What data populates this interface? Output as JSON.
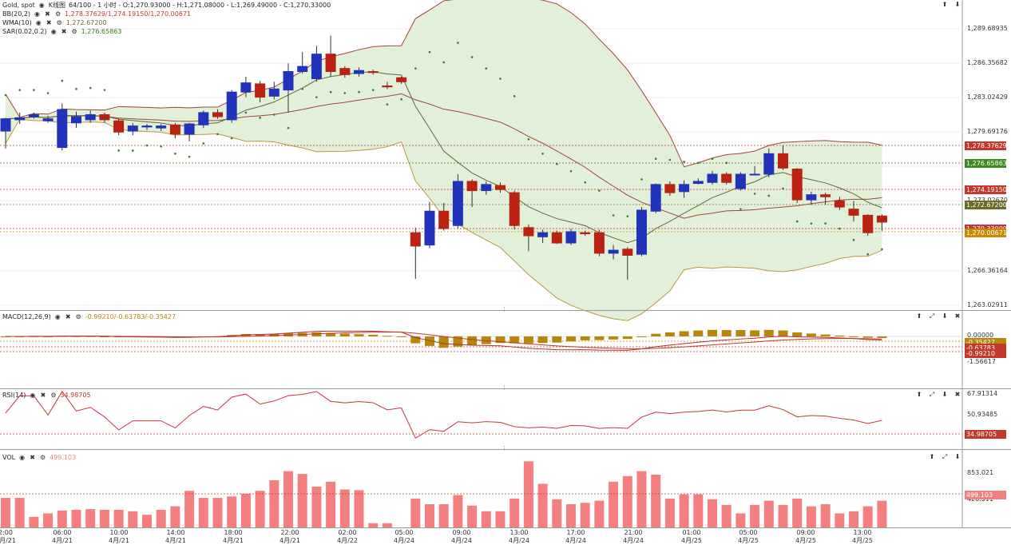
{
  "main": {
    "symbol": "Gold, spot",
    "chart_type_label": "K线图",
    "ohlc_text": "64/100 - 1 小时 - O:1,270.93000 - H:1,271.08000 - L:1,269.49000 - C:1,270.33000",
    "indicators": [
      {
        "name": "BB(20,2)",
        "values": "1,278.37629/1,274.19150/1,270.00671",
        "color": "#c0392b"
      },
      {
        "name": "WMA(10)",
        "values": "1,272.67200",
        "color": "#6b6b2a"
      },
      {
        "name": "SAR(0.02,0.2)",
        "values": "1,276.65863",
        "color": "#3a7d1a"
      }
    ],
    "y_ticks": [
      "1,289.68935",
      "1,286.35682",
      "1,283.02429",
      "1,279.69176",
      "1,276.36",
      "1,273.02670",
      "1,269.69",
      "1,266.36164",
      "1,263.02911"
    ],
    "price_labels": [
      {
        "text": "1,278.37629",
        "color": "#c0392b"
      },
      {
        "text": "1,276.65863",
        "color": "#3c8a1e"
      },
      {
        "text": "1,274.19150",
        "color": "#c0392b"
      },
      {
        "text": "1,272.67200",
        "color": "#6b6b2a"
      },
      {
        "text": "1,270.33000",
        "color": "#c0392b"
      },
      {
        "text": "1,270.00671",
        "color": "#c88a00"
      }
    ],
    "ctrl_icons": [
      "up-arrow-icon",
      "down-arrow-icon"
    ]
  },
  "macd": {
    "name": "MACD(12,26,9)",
    "values": "-0.99210/-0.63783/-0.35427",
    "y_ticks": [
      "0.00000",
      "-1.56617"
    ],
    "price_labels": [
      {
        "text": "-0.35427",
        "color": "#b8860b"
      },
      {
        "text": "-0.63783",
        "color": "#c0392b"
      },
      {
        "text": "-0.99210",
        "color": "#c0392b"
      }
    ]
  },
  "rsi": {
    "name": "RSI(14)",
    "values": "34.98705",
    "y_ticks": [
      "67.91314",
      "50.93485"
    ],
    "price_label": "34.98705"
  },
  "vol": {
    "name": "VOL",
    "values": "499.103",
    "y_ticks": [
      "853.021",
      "426.511"
    ],
    "price_label": "499.103"
  },
  "x_axis": {
    "times": [
      "2:00",
      "06:00",
      "10:00",
      "14:00",
      "18:00",
      "22:00",
      "02:00",
      "05:00",
      "09:00",
      "13:00",
      "17:00",
      "21:00",
      "01:00",
      "05:00",
      "09:00",
      "13:00"
    ],
    "dates": [
      "4月/21",
      "4月/21",
      "4月/21",
      "4月/21",
      "4月/21",
      "4月/21",
      "4月/22",
      "4月/24",
      "4月/24",
      "4月/24",
      "4月/24",
      "4月/24",
      "4月/25",
      "4月/25",
      "4月/25",
      "4月/25"
    ]
  },
  "chart_data": {
    "type": "candlestick",
    "price_range": [
      1262.0,
      1291.5
    ],
    "candles": [
      [
        1279.2,
        1280.4,
        1277.5,
        1280.5
      ],
      [
        1280.3,
        1280.5,
        1279.9,
        1281.0
      ],
      [
        1280.6,
        1280.8,
        1280.4,
        1281.0
      ],
      [
        1280.2,
        1280.4,
        1280.0,
        1280.7
      ],
      [
        1277.6,
        1281.3,
        1277.3,
        1281.9
      ],
      [
        1280.0,
        1280.6,
        1279.5,
        1281.1
      ],
      [
        1280.3,
        1280.8,
        1280.0,
        1281.2
      ],
      [
        1280.8,
        1280.3,
        1280.0,
        1281.0
      ],
      [
        1280.2,
        1279.1,
        1278.8,
        1280.4
      ],
      [
        1279.2,
        1279.7,
        1278.8,
        1280.0
      ],
      [
        1279.6,
        1279.7,
        1279.3,
        1279.9
      ],
      [
        1279.5,
        1279.7,
        1279.2,
        1279.9
      ],
      [
        1279.8,
        1278.9,
        1278.5,
        1280.0
      ],
      [
        1278.9,
        1279.9,
        1278.2,
        1280.0
      ],
      [
        1279.8,
        1281.0,
        1279.5,
        1281.2
      ],
      [
        1281.0,
        1280.6,
        1280.4,
        1281.3
      ],
      [
        1280.3,
        1283.0,
        1280.0,
        1283.2
      ],
      [
        1283.0,
        1283.9,
        1282.5,
        1284.5
      ],
      [
        1283.8,
        1282.5,
        1282.0,
        1284.1
      ],
      [
        1282.6,
        1283.3,
        1282.3,
        1284.0
      ],
      [
        1283.2,
        1285.0,
        1281.0,
        1285.8
      ],
      [
        1285.0,
        1285.5,
        1284.8,
        1286.9
      ],
      [
        1284.3,
        1286.7,
        1284.0,
        1287.5
      ],
      [
        1286.7,
        1285.0,
        1284.5,
        1288.5
      ],
      [
        1285.3,
        1284.7,
        1284.4,
        1285.5
      ],
      [
        1284.8,
        1285.1,
        1284.5,
        1285.4
      ],
      [
        1285.0,
        1284.9,
        1284.7,
        1285.2
      ],
      [
        1283.6,
        1283.5,
        1283.3,
        1284.0
      ],
      [
        1284.4,
        1284.0,
        1283.8,
        1284.5
      ],
      [
        1269.3,
        1268.0,
        1264.8,
        1269.8
      ],
      [
        1268.1,
        1271.4,
        1267.8,
        1272.3
      ],
      [
        1271.4,
        1269.7,
        1269.5,
        1272.2
      ],
      [
        1270.0,
        1274.3,
        1269.7,
        1275.0
      ],
      [
        1274.3,
        1273.4,
        1271.8,
        1274.5
      ],
      [
        1273.4,
        1274.0,
        1273.0,
        1274.3
      ],
      [
        1273.9,
        1273.5,
        1273.2,
        1274.2
      ],
      [
        1273.2,
        1270.0,
        1269.6,
        1273.4
      ],
      [
        1269.8,
        1269.0,
        1267.5,
        1270.1
      ],
      [
        1268.9,
        1269.3,
        1268.3,
        1269.6
      ],
      [
        1269.3,
        1268.3,
        1268.2,
        1269.5
      ],
      [
        1268.3,
        1269.4,
        1268.1,
        1269.7
      ],
      [
        1269.3,
        1269.2,
        1269.0,
        1269.5
      ],
      [
        1269.3,
        1267.3,
        1267.0,
        1269.6
      ],
      [
        1267.3,
        1267.6,
        1266.7,
        1268.1
      ],
      [
        1267.7,
        1267.1,
        1264.7,
        1267.9
      ],
      [
        1267.2,
        1271.5,
        1267.0,
        1271.8
      ],
      [
        1271.4,
        1274.0,
        1271.2,
        1274.1
      ],
      [
        1274.0,
        1273.2,
        1272.9,
        1274.3
      ],
      [
        1273.3,
        1274.0,
        1272.7,
        1274.4
      ],
      [
        1274.1,
        1274.3,
        1274.0,
        1274.6
      ],
      [
        1274.2,
        1275.0,
        1274.0,
        1275.3
      ],
      [
        1275.0,
        1274.2,
        1274.0,
        1275.2
      ],
      [
        1273.6,
        1275.0,
        1273.4,
        1275.2
      ],
      [
        1275.0,
        1275.0,
        1274.9,
        1275.8
      ],
      [
        1275.0,
        1277.0,
        1274.7,
        1277.5
      ],
      [
        1277.0,
        1275.6,
        1275.4,
        1277.8
      ],
      [
        1275.5,
        1272.5,
        1272.2,
        1275.6
      ],
      [
        1272.5,
        1273.0,
        1272.0,
        1273.3
      ],
      [
        1273.0,
        1272.8,
        1272.0,
        1273.2
      ],
      [
        1272.4,
        1271.8,
        1271.5,
        1272.8
      ],
      [
        1271.6,
        1271.0,
        1270.4,
        1272.4
      ],
      [
        1271.0,
        1269.3,
        1269.0,
        1271.1
      ],
      [
        1270.93,
        1270.33,
        1269.49,
        1271.08
      ]
    ]
  }
}
